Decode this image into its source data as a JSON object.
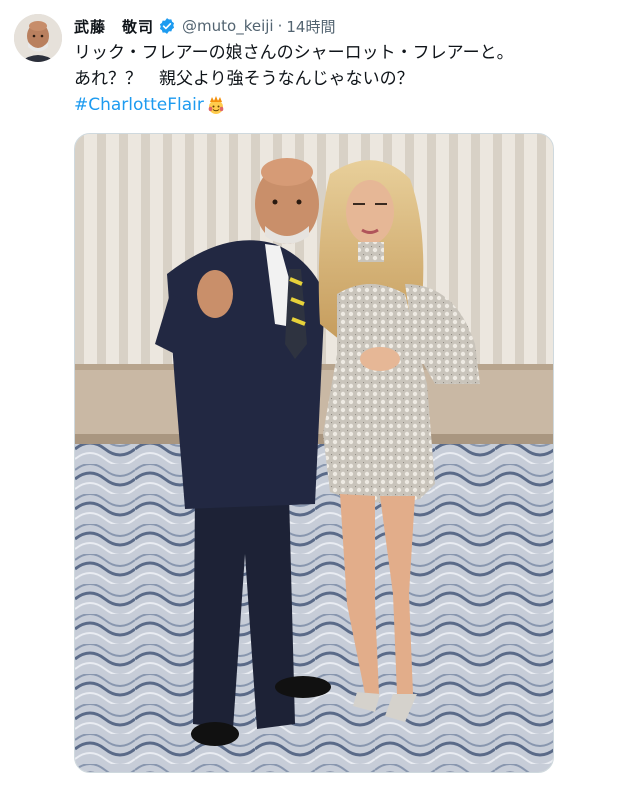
{
  "tweet": {
    "author": {
      "display_name": "武藤　敬司",
      "handle": "@muto_keiji",
      "verified": true,
      "avatar_icon": "bald-man-avatar"
    },
    "separator": "·",
    "timestamp": "14時間",
    "text_lines": [
      "リック・フレアーの娘さんのシャーロット・フレアーと。",
      "あれ？？　親父より強そうなんじゃないの？"
    ],
    "hashtag": "#CharlotteFlair",
    "hashtag_emoji": "crowned-face-emoji",
    "media": {
      "type": "photo",
      "icon": "photo-man-in-suit-and-woman-in-sequin-dress"
    },
    "colors": {
      "link": "#1d9bf0",
      "verified": "#1d9bf0",
      "secondary_text": "#536471"
    }
  }
}
